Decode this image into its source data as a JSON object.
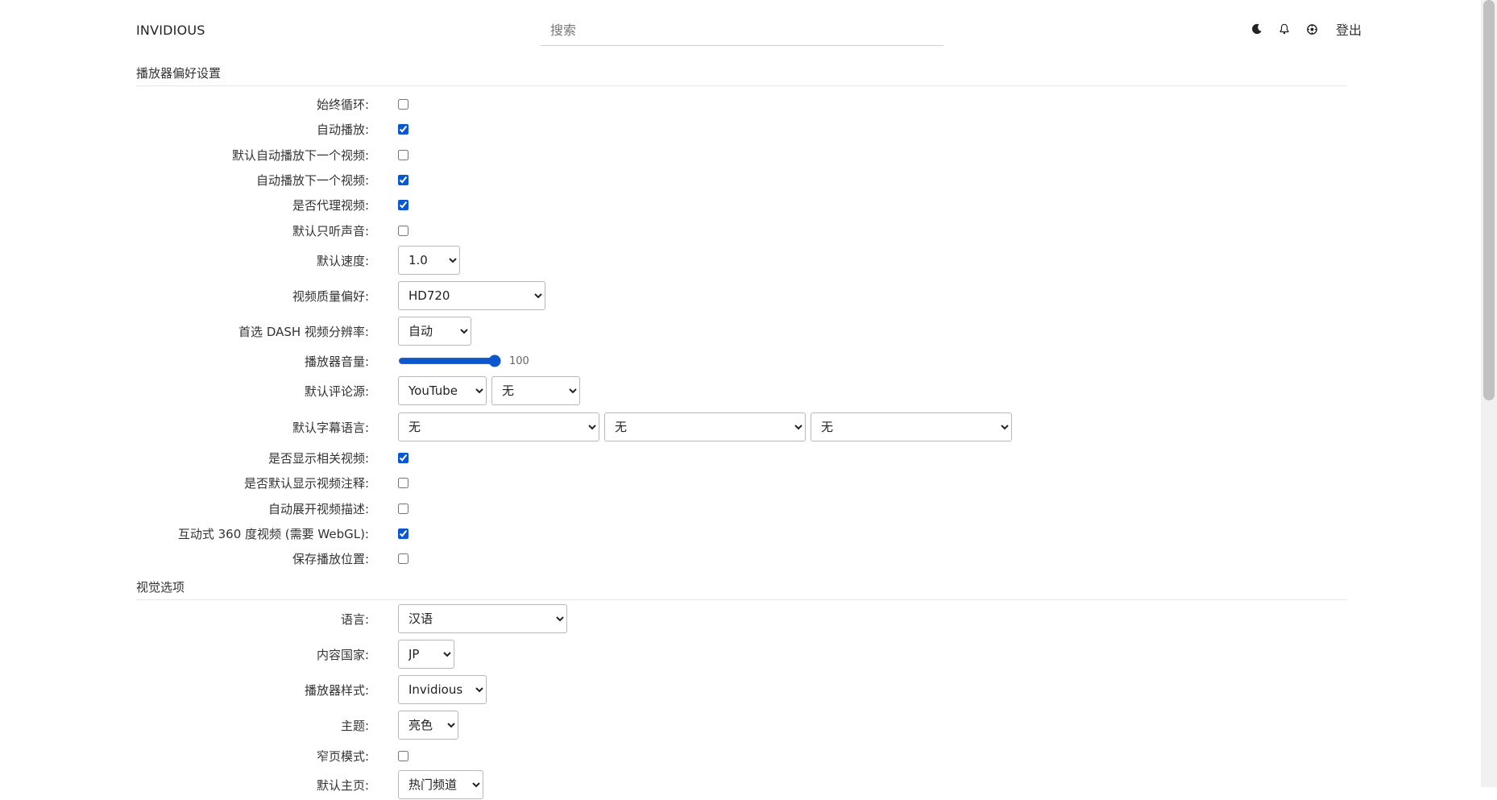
{
  "header": {
    "brand": "INVIDIOUS",
    "search_placeholder": "搜索",
    "icons": [
      "moon-icon",
      "bell-icon",
      "preferences-icon"
    ],
    "logout_label": "登出"
  },
  "player_section": {
    "title": "播放器偏好设置",
    "always_loop": {
      "label": "始终循环:",
      "checked": false
    },
    "autoplay": {
      "label": "自动播放:",
      "checked": true
    },
    "autoplay_next_default": {
      "label": "默认自动播放下一个视频:",
      "checked": false
    },
    "autoplay_next": {
      "label": "自动播放下一个视频:",
      "checked": true
    },
    "proxy_video": {
      "label": "是否代理视频:",
      "checked": true
    },
    "audio_only": {
      "label": "默认只听声音:",
      "checked": false
    },
    "speed": {
      "label": "默认速度:",
      "value": "1.0"
    },
    "quality": {
      "label": "视频质量偏好:",
      "value": "HD720"
    },
    "dash_quality": {
      "label": "首选 DASH 视频分辨率:",
      "value": "自动"
    },
    "volume": {
      "label": "播放器音量:",
      "value": "100"
    },
    "comments": {
      "label": "默认评论源:",
      "value1": "YouTube",
      "value2": "无"
    },
    "captions": {
      "label": "默认字幕语言:",
      "value1": "无",
      "value2": "无",
      "value3": "无"
    },
    "related_videos": {
      "label": "是否显示相关视频:",
      "checked": true
    },
    "annotations": {
      "label": "是否默认显示视频注释:",
      "checked": false
    },
    "expand_description": {
      "label": "自动展开视频描述:",
      "checked": false
    },
    "vr_mode": {
      "label": "互动式 360 度视频 (需要 WebGL):",
      "checked": true
    },
    "save_position": {
      "label": "保存播放位置:",
      "checked": false
    }
  },
  "visual_section": {
    "title": "视觉选项",
    "language": {
      "label": "语言:",
      "value": "汉语"
    },
    "region": {
      "label": "内容国家:",
      "value": "JP"
    },
    "player_style": {
      "label": "播放器样式:",
      "value": "Invidious"
    },
    "theme": {
      "label": "主题:",
      "value": "亮色"
    },
    "thin_mode": {
      "label": "窄页模式:",
      "checked": false
    },
    "default_home": {
      "label": "默认主页:",
      "value": "热门频道"
    }
  },
  "colors": {
    "accent": "#0b57d0",
    "rule": "#e6e6e6",
    "text": "#303030"
  }
}
